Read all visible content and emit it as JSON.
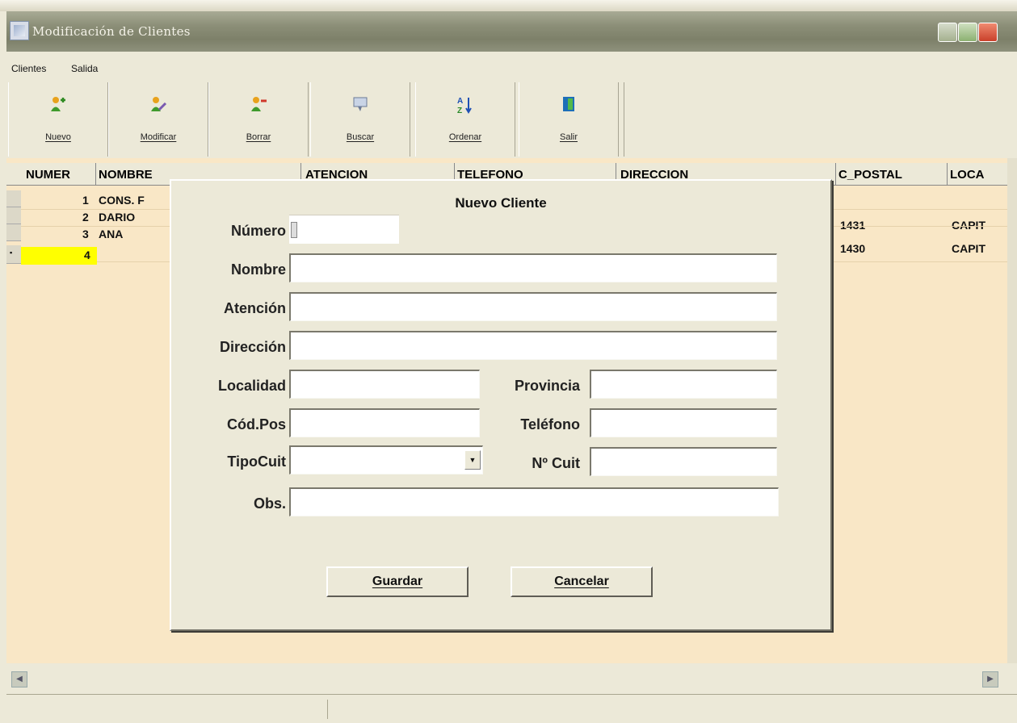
{
  "window": {
    "title": "Modificación de Clientes"
  },
  "menu": [
    "Clientes",
    "Salida"
  ],
  "toolbar": [
    {
      "label": "Nuevo",
      "icon": "user-add-icon"
    },
    {
      "label": "Modificar",
      "icon": "user-edit-icon"
    },
    {
      "label": "Borrar",
      "icon": "user-delete-icon"
    },
    {
      "label": "Buscar",
      "icon": "search-icon"
    },
    {
      "label": "Ordenar",
      "icon": "sort-az-icon"
    },
    {
      "label": "Salir",
      "icon": "exit-door-icon"
    }
  ],
  "grid": {
    "columns": [
      "NUMER",
      "NOMBRE",
      "ATENCION",
      "TELEFONO",
      "DIRECCION",
      "C_POSTAL",
      "LOCA"
    ],
    "rows": [
      {
        "numero": "1",
        "nombre": "CONS. F",
        "c_postal": "",
        "localidad": ""
      },
      {
        "numero": "2",
        "nombre": "DARIO",
        "c_postal": "1431",
        "localidad": "CAPIT"
      },
      {
        "numero": "3",
        "nombre": "ANA",
        "c_postal": "1430",
        "localidad": "CAPIT"
      },
      {
        "numero": "4",
        "nombre": "",
        "c_postal": "",
        "localidad": ""
      }
    ],
    "selected_row": 4,
    "row_background": "#f9e7c6",
    "selected_cell_color": "#ffff00"
  },
  "dialog": {
    "title": "Nuevo Cliente",
    "fields": {
      "numero": {
        "label": "Número",
        "value": ""
      },
      "nombre": {
        "label": "Nombre",
        "value": ""
      },
      "atencion": {
        "label": "Atención",
        "value": ""
      },
      "direccion": {
        "label": "Dirección",
        "value": ""
      },
      "localidad": {
        "label": "Localidad",
        "value": ""
      },
      "provincia": {
        "label": "Provincia",
        "value": ""
      },
      "codpos": {
        "label": "Cód.Pos",
        "value": ""
      },
      "telefono": {
        "label": "Teléfono",
        "value": ""
      },
      "tipocuit": {
        "label": "TipoCuit",
        "value": ""
      },
      "nro_cuit": {
        "label": "Nº Cuit",
        "value": ""
      },
      "obs": {
        "label": "Obs.",
        "value": ""
      }
    },
    "buttons": {
      "save": "Guardar",
      "cancel": "Cancelar"
    }
  }
}
